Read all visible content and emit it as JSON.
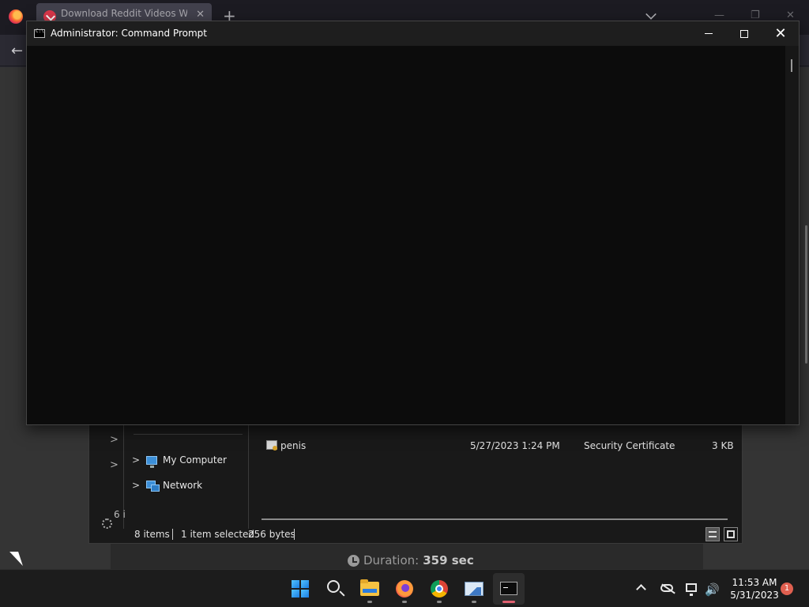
{
  "browser": {
    "tab_title": "Download Reddit Videos With",
    "tab_close": "✕",
    "new_tab": "+",
    "back": "←"
  },
  "file_dialog": {
    "nav": {
      "items": [
        {
          "label": "My Computer",
          "icon": "monitor-icon"
        },
        {
          "label": "Network",
          "icon": "network-icon"
        }
      ]
    },
    "files": [
      {
        "name": "penis",
        "date": "5/27/2023 1:24 PM",
        "type": "Security Certificate",
        "size": "3 KB"
      }
    ],
    "status": {
      "items_count": "8 items",
      "selected": "1 item selected",
      "selected_size": "256 bytes"
    },
    "partial_text": "6 i"
  },
  "duration": {
    "label": "Duration:",
    "value": "359 sec"
  },
  "cmd": {
    "title": "Administrator:  Command Prompt",
    "close": "✕"
  },
  "taskbar": {
    "apps": [
      {
        "name": "start",
        "icon": "windows-logo-icon"
      },
      {
        "name": "search",
        "icon": "search-icon"
      },
      {
        "name": "file-explorer",
        "icon": "folder-icon"
      },
      {
        "name": "firefox",
        "icon": "firefox-icon"
      },
      {
        "name": "chrome",
        "icon": "chrome-icon"
      },
      {
        "name": "photos",
        "icon": "photo-icon"
      },
      {
        "name": "terminal",
        "icon": "terminal-icon"
      }
    ],
    "time": "11:53 AM",
    "date": "5/31/2023",
    "notifications": "1",
    "volume": "🔊"
  }
}
